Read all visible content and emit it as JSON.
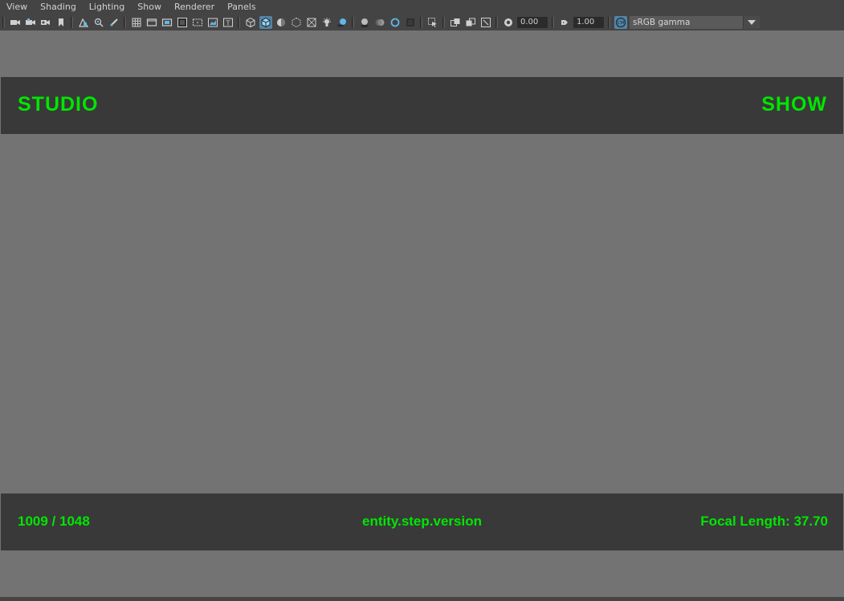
{
  "menubar": {
    "items": [
      "View",
      "Shading",
      "Lighting",
      "Show",
      "Renderer",
      "Panels"
    ]
  },
  "toolbar": {
    "icons": [
      "select-camera-icon",
      "camera-attributes-icon",
      "bookmarks-icon",
      "bookmark-icon",
      "image-plane-icon",
      "2d-pan-zoom-icon",
      "grease-pencil-icon",
      "grid-icon",
      "film-gate-icon",
      "resolution-gate-icon",
      "gate-mask-icon",
      "field-chart-icon",
      "safe-action-icon",
      "safe-title-icon",
      "wireframe-icon",
      "smooth-shade-icon",
      "default-material-icon",
      "xray-icon",
      "xray-joints-icon",
      "use-all-lights-icon",
      "shadows-icon",
      "screen-space-ao-icon",
      "motion-blur-icon",
      "anti-aliasing-icon",
      "depth-of-field-icon",
      "isolate-select-icon",
      "xray-active-icon",
      "toggle-hud-icon",
      "exposure-icon",
      "gamma-icon",
      "color-management-icon"
    ],
    "exposure_value": "0.00",
    "gamma_value": "1.00",
    "colorspace": "sRGB gamma"
  },
  "hud": {
    "studio": "STUDIO",
    "show": "SHOW",
    "frame_counter": "1009 / 1048",
    "entity": "entity.step.version",
    "focal_length": "Focal Length: 37.70",
    "color": "#00e600"
  },
  "colors": {
    "ui_background": "#444444",
    "viewport_background": "#737373",
    "hud_band": "#393939",
    "active_icon": "#5285a6"
  }
}
